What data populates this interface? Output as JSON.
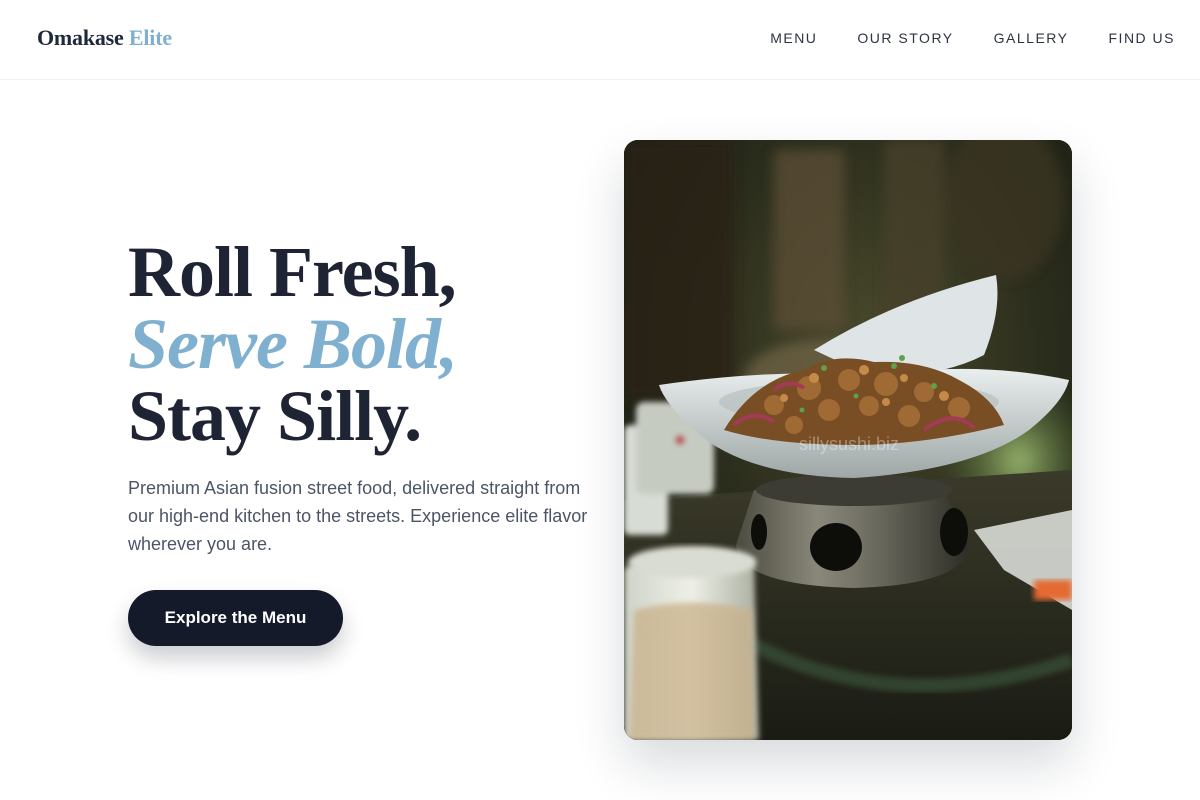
{
  "brand": {
    "name": "Omakase",
    "accent": "Elite"
  },
  "nav": {
    "items": [
      {
        "label": "MENU"
      },
      {
        "label": "OUR STORY"
      },
      {
        "label": "GALLERY"
      },
      {
        "label": "FIND US"
      }
    ]
  },
  "hero": {
    "headline_line1": "Roll Fresh,",
    "headline_line2": "Serve Bold,",
    "headline_line3": "Stay Silly.",
    "description": "Premium Asian fusion street food, delivered straight from our high-end kitchen to the streets. Experience elite flavor wherever you are.",
    "cta_label": "Explore the Menu",
    "image_alt": "Dish served in a bowl on a metal warmer stand",
    "watermark": "sillysushi.biz"
  },
  "colors": {
    "accent": "#7fb0d0",
    "dark": "#141a29",
    "text": "#1e2433",
    "muted": "#4b5565"
  }
}
